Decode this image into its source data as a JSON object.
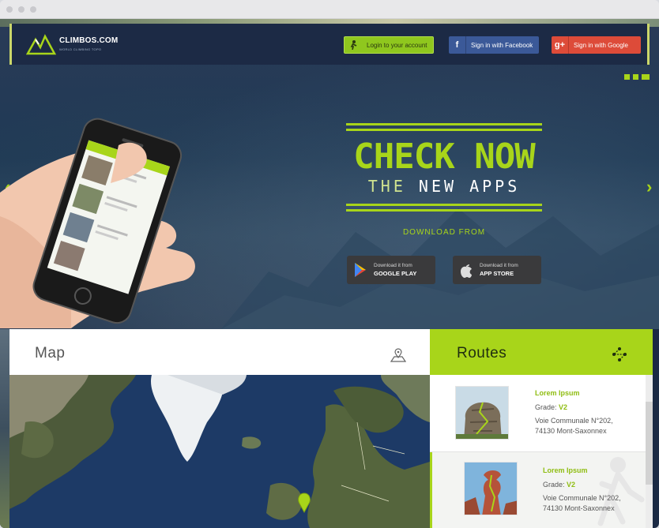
{
  "browser": {
    "dots": 3
  },
  "header": {
    "logo_text": "CLIMBOS.COM",
    "logo_sub": "WORLD CLIMBING TOPO",
    "login_label": "Login to your account",
    "facebook_label": "Sign in with Facebook",
    "google_label": "Sign in with Google"
  },
  "hero": {
    "headline": "CHECK NOW",
    "subline_the": "THE",
    "subline_rest": "NEW APPS",
    "download_from": "DOWNLOAD FROM",
    "google_play": {
      "small": "Download it from",
      "big": "GOOGLE PLAY"
    },
    "app_store": {
      "small": "Download it from",
      "big": "APP STORE"
    },
    "prev_arrow": "‹",
    "next_arrow": "›"
  },
  "map": {
    "title": "Map",
    "icon": "map-pin-icon"
  },
  "routes": {
    "title": "Routes",
    "icon": "route-icon",
    "items": [
      {
        "name": "Lorem Ipsum",
        "grade_label": "Grade:",
        "grade": "V2",
        "addr1": "Voie Communale N°202,",
        "addr2": "74130 Mont-Saxonnex"
      },
      {
        "name": "Lorem Ipsum",
        "grade_label": "Grade:",
        "grade": "V2",
        "addr1": "Voie Communale N°202,",
        "addr2": "74130 Mont-Saxonnex"
      }
    ]
  },
  "colors": {
    "accent": "#a8d51a",
    "navy": "#1c2a45",
    "facebook": "#3b5998",
    "google": "#dd4b39"
  }
}
